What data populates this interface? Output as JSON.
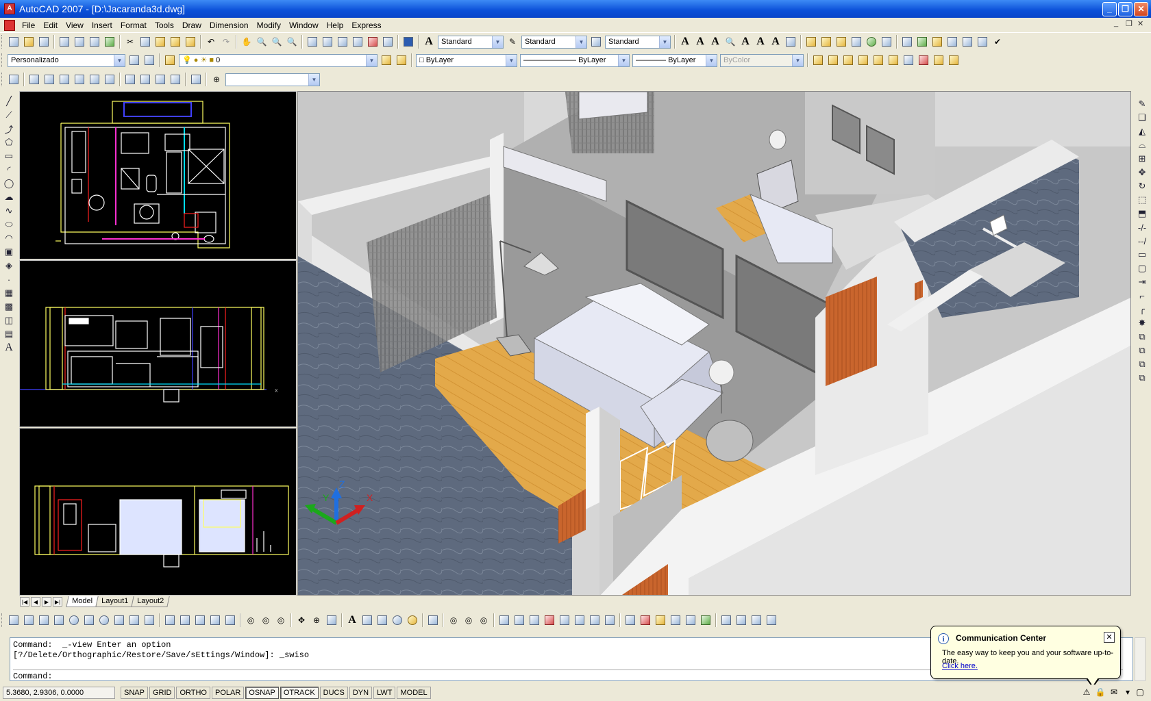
{
  "window": {
    "title": "AutoCAD 2007 - [D:\\Jacaranda3d.dwg]"
  },
  "menu": [
    "File",
    "Edit",
    "View",
    "Insert",
    "Format",
    "Tools",
    "Draw",
    "Dimension",
    "Modify",
    "Window",
    "Help",
    "Express"
  ],
  "styles": {
    "text_style": "Standard",
    "dim_style": "Standard",
    "table_style": "Standard"
  },
  "workspace": {
    "value": "Personalizado"
  },
  "layer": {
    "current": "0"
  },
  "properties": {
    "color": "ByLayer",
    "linetype": "ByLayer",
    "lineweight": "ByLayer",
    "plotstyle": "ByColor"
  },
  "layout_tabs": [
    "Model",
    "Layout1",
    "Layout2"
  ],
  "command": {
    "line1": "Command:  _-view Enter an option",
    "line2": "[?/Delete/Orthographic/Restore/Save/sEttings/Window]: _swiso",
    "prompt": "Command:"
  },
  "status": {
    "coords": "5.3680, 2.9306, 0.0000",
    "toggles": [
      "SNAP",
      "GRID",
      "ORTHO",
      "POLAR",
      "OSNAP",
      "OTRACK",
      "DUCS",
      "DYN",
      "LWT",
      "MODEL"
    ]
  },
  "communication_center": {
    "title": "Communication Center",
    "message": "The easy way to keep you and your software up-to-date.",
    "link": "Click here."
  },
  "ucs_icon": {
    "x": "X",
    "y": "Y",
    "z": "Z"
  }
}
